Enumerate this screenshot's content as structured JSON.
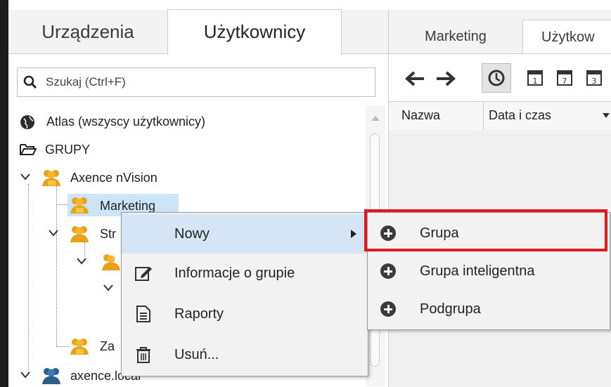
{
  "left_tabs": [
    {
      "label": "Urządzenia",
      "active": false
    },
    {
      "label": "Użytkownicy",
      "active": true
    }
  ],
  "search": {
    "placeholder": "Szukaj (Ctrl+F)"
  },
  "tree": {
    "atlas": "Atlas (wszyscy użytkownicy)",
    "groups_header": "GRUPY",
    "axence": "Axence nVision",
    "marketing": "Marketing",
    "str_partial": "Str",
    "za_partial": "Za",
    "axence_local": "axence.local"
  },
  "right_tabs": [
    {
      "label": "Marketing",
      "active": false
    },
    {
      "label": "Użytkow",
      "active": true
    }
  ],
  "columns": {
    "name": "Nazwa",
    "datetime": "Data i czas"
  },
  "context_menu": {
    "items": [
      {
        "label": "Nowy",
        "icon": "none",
        "has_submenu": true
      },
      {
        "label": "Informacje o grupie",
        "icon": "edit-icon"
      },
      {
        "label": "Raporty",
        "icon": "report-icon"
      },
      {
        "label": "Usuń...",
        "icon": "trash-icon"
      }
    ]
  },
  "submenu": {
    "items": [
      {
        "label": "Grupa",
        "icon": "plus-circle-icon",
        "highlighted_box": true
      },
      {
        "label": "Grupa inteligentna",
        "icon": "plus-circle-icon"
      },
      {
        "label": "Podgrupa",
        "icon": "plus-circle-icon"
      }
    ]
  },
  "colors": {
    "highlight_box": "#e0191b",
    "menu_hover": "#d6e5f5",
    "selected_row": "#cce4f7"
  }
}
